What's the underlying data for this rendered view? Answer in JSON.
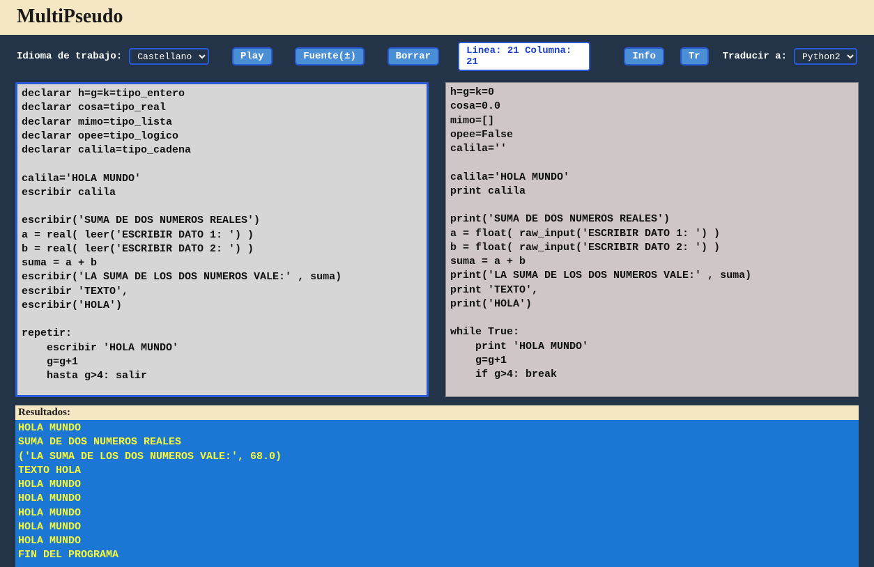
{
  "header": {
    "title": "MultiPseudo"
  },
  "toolbar": {
    "lang_label": "Idioma de trabajo:",
    "lang_options": [
      "Castellano"
    ],
    "lang_selected": "Castellano",
    "play": "Play",
    "fuente": "Fuente(±)",
    "borrar": "Borrar",
    "status": "Linea: 21 Columna: 21",
    "info": "Info",
    "tr": "Tr",
    "translate_label": "Traducir a:",
    "translate_options": [
      "Python2"
    ],
    "translate_selected": "Python2"
  },
  "source_code": "declarar h=g=k=tipo_entero\ndeclarar cosa=tipo_real\ndeclarar mimo=tipo_lista\ndeclarar opee=tipo_logico\ndeclarar calila=tipo_cadena\n\ncalila='HOLA MUNDO'\nescribir calila\n\nescribir('SUMA DE DOS NUMEROS REALES')\na = real( leer('ESCRIBIR DATO 1: ') )\nb = real( leer('ESCRIBIR DATO 2: ') )\nsuma = a + b\nescribir('LA SUMA DE LOS DOS NUMEROS VALE:' , suma)\nescribir 'TEXTO',\nescribir('HOLA')\n\nrepetir:\n    escribir 'HOLA MUNDO'\n    g=g+1\n    hasta g>4: salir",
  "translated_code": "h=g=k=0\ncosa=0.0\nmimo=[]\nopee=False\ncalila=''\n\ncalila='HOLA MUNDO'\nprint calila\n\nprint('SUMA DE DOS NUMEROS REALES')\na = float( raw_input('ESCRIBIR DATO 1: ') )\nb = float( raw_input('ESCRIBIR DATO 2: ') )\nsuma = a + b\nprint('LA SUMA DE LOS DOS NUMEROS VALE:' , suma)\nprint 'TEXTO',\nprint('HOLA')\n\nwhile True:\n    print 'HOLA MUNDO'\n    g=g+1\n    if g>4: break",
  "results": {
    "header": "Resultados:",
    "output": "HOLA MUNDO\nSUMA DE DOS NUMEROS REALES\n('LA SUMA DE LOS DOS NUMEROS VALE:', 68.0)\nTEXTO HOLA\nHOLA MUNDO\nHOLA MUNDO\nHOLA MUNDO\nHOLA MUNDO\nHOLA MUNDO\nFIN DEL PROGRAMA"
  }
}
